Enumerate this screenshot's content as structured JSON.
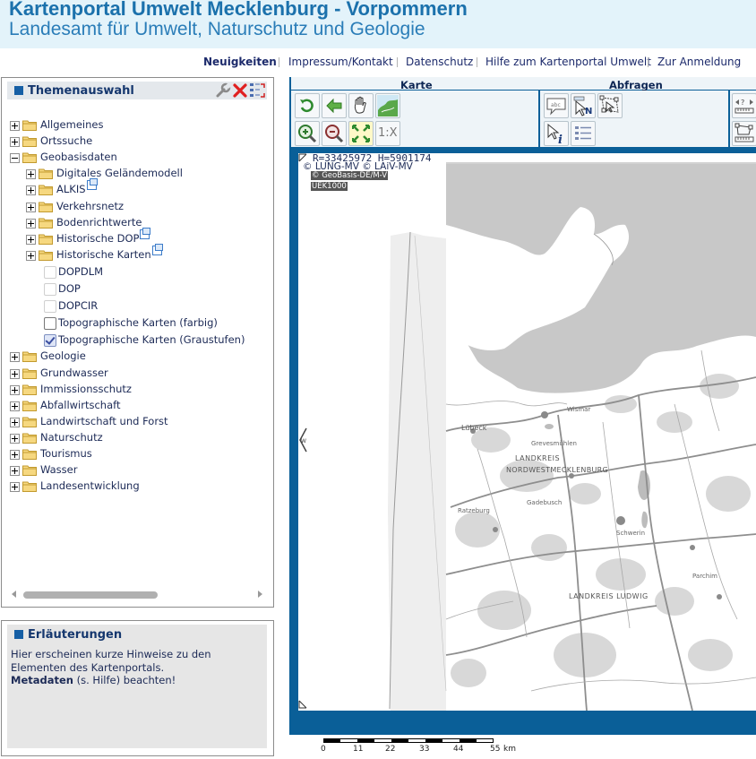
{
  "header": {
    "title": "Kartenportal Umwelt Mecklenburg - Vorpommern",
    "subtitle": "Landesamt für Umwelt, Naturschutz und Geologie"
  },
  "nav": {
    "items": [
      {
        "label": "Neuigkeiten",
        "bold": true
      },
      {
        "label": "Impressum/Kontakt"
      },
      {
        "label": "Datenschutz"
      },
      {
        "label": "Hilfe zum Kartenportal Umwelt"
      },
      {
        "label": "Zur Anmeldung"
      }
    ]
  },
  "theme_panel": {
    "title": "Themenauswahl",
    "tools": [
      "wrench-icon",
      "close-icon",
      "expand-icon"
    ],
    "tree": [
      {
        "label": "Allgemeines",
        "type": "folder",
        "expanded": false
      },
      {
        "label": "Ortssuche",
        "type": "folder",
        "expanded": false
      },
      {
        "label": "Geobasisdaten",
        "type": "folder",
        "expanded": true
      },
      {
        "label": "Digitales Geländemodell",
        "type": "folder",
        "expanded": false
      },
      {
        "label": "ALKIS",
        "type": "folder",
        "expanded": false,
        "external": true
      },
      {
        "label": "Verkehrsnetz",
        "type": "folder",
        "expanded": false
      },
      {
        "label": "Bodenrichtwerte",
        "type": "folder",
        "expanded": false
      },
      {
        "label": "Historische DOP",
        "type": "folder",
        "expanded": false,
        "external": true
      },
      {
        "label": "Historische Karten",
        "type": "folder",
        "expanded": false,
        "external": true
      },
      {
        "label": "DOPDLM",
        "type": "checkbox",
        "checked": false,
        "disabled": true
      },
      {
        "label": "DOP",
        "type": "checkbox",
        "checked": false,
        "disabled": true
      },
      {
        "label": "DOPCIR",
        "type": "checkbox",
        "checked": false,
        "disabled": true
      },
      {
        "label": "Topographische Karten (farbig)",
        "type": "checkbox",
        "checked": false,
        "disabled": false
      },
      {
        "label": "Topographische Karten (Graustufen)",
        "type": "checkbox",
        "checked": true,
        "disabled": false
      },
      {
        "label": "Geologie",
        "type": "folder",
        "expanded": false
      },
      {
        "label": "Grundwasser",
        "type": "folder",
        "expanded": false
      },
      {
        "label": "Immissionsschutz",
        "type": "folder",
        "expanded": false
      },
      {
        "label": "Abfallwirtschaft",
        "type": "folder",
        "expanded": false
      },
      {
        "label": "Landwirtschaft und Forst",
        "type": "folder",
        "expanded": false
      },
      {
        "label": "Naturschutz",
        "type": "folder",
        "expanded": false
      },
      {
        "label": "Tourismus",
        "type": "folder",
        "expanded": false
      },
      {
        "label": "Wasser",
        "type": "folder",
        "expanded": false
      },
      {
        "label": "Landesentwicklung",
        "type": "folder",
        "expanded": false
      }
    ]
  },
  "explanation": {
    "title": "Erläuterungen",
    "text": "Hier erscheinen kurze Hinweise zu den Elementen des Kartenportals.",
    "metadata_bold": "Metadaten",
    "metadata_rest": " (s. Hilfe) beachten!"
  },
  "map": {
    "toolbar": {
      "group_karte": "Karte",
      "group_abfragen": "Abfragen",
      "scale_button": "1:X"
    },
    "coords": "R=33425972 H=5901174",
    "copyright1": "© LUNG-MV © LAiV-MV",
    "copyright2": "© GeoBasis-DE/M-V",
    "layer_tag": "UEK1000",
    "labels": [
      "Lübeck",
      "LANDKREIS",
      "NORDWESTMECKLENBURG",
      "LANDKREIS LUDWIG",
      "Grevesmühlen",
      "Wismar",
      "Schwerin",
      "Gadebusch",
      "Ratzeburg",
      "Parchim"
    ]
  },
  "scalebar": {
    "ticks": [
      "0",
      "11",
      "22",
      "33",
      "44",
      "55"
    ],
    "unit": "km"
  },
  "colors": {
    "accent": "#1b71ac",
    "map_frame": "#0a5f98",
    "water": "#c8c8c8"
  }
}
